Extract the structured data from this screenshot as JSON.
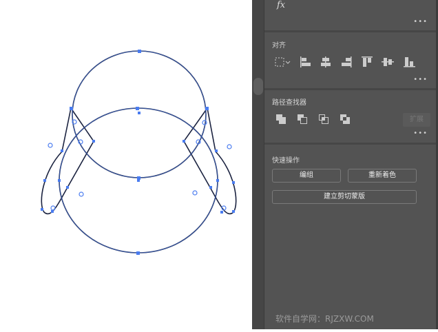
{
  "panel": {
    "appearance": {
      "fx_label": "fx"
    },
    "align": {
      "title": "对齐",
      "icons": [
        "align-to-selection-icon",
        "align-left-icon",
        "align-horizontal-center-icon",
        "align-right-icon",
        "align-top-icon",
        "align-vertical-center-icon",
        "align-bottom-icon"
      ]
    },
    "pathfinder": {
      "title": "路径查找器",
      "icons": [
        "unite-icon",
        "minus-front-icon",
        "intersect-icon",
        "exclude-icon"
      ],
      "expand_label": "扩展"
    },
    "quick_actions": {
      "title": "快速操作",
      "group_label": "编组",
      "recolor_label": "重新着色",
      "clip_mask_label": "建立剪切蒙版"
    },
    "more_label": "•••"
  },
  "watermark": "软件自学网：RJZXW.COM",
  "colors": {
    "selection": "#4a7cf0",
    "path": "#1a1a2e",
    "panel": "#535353"
  }
}
